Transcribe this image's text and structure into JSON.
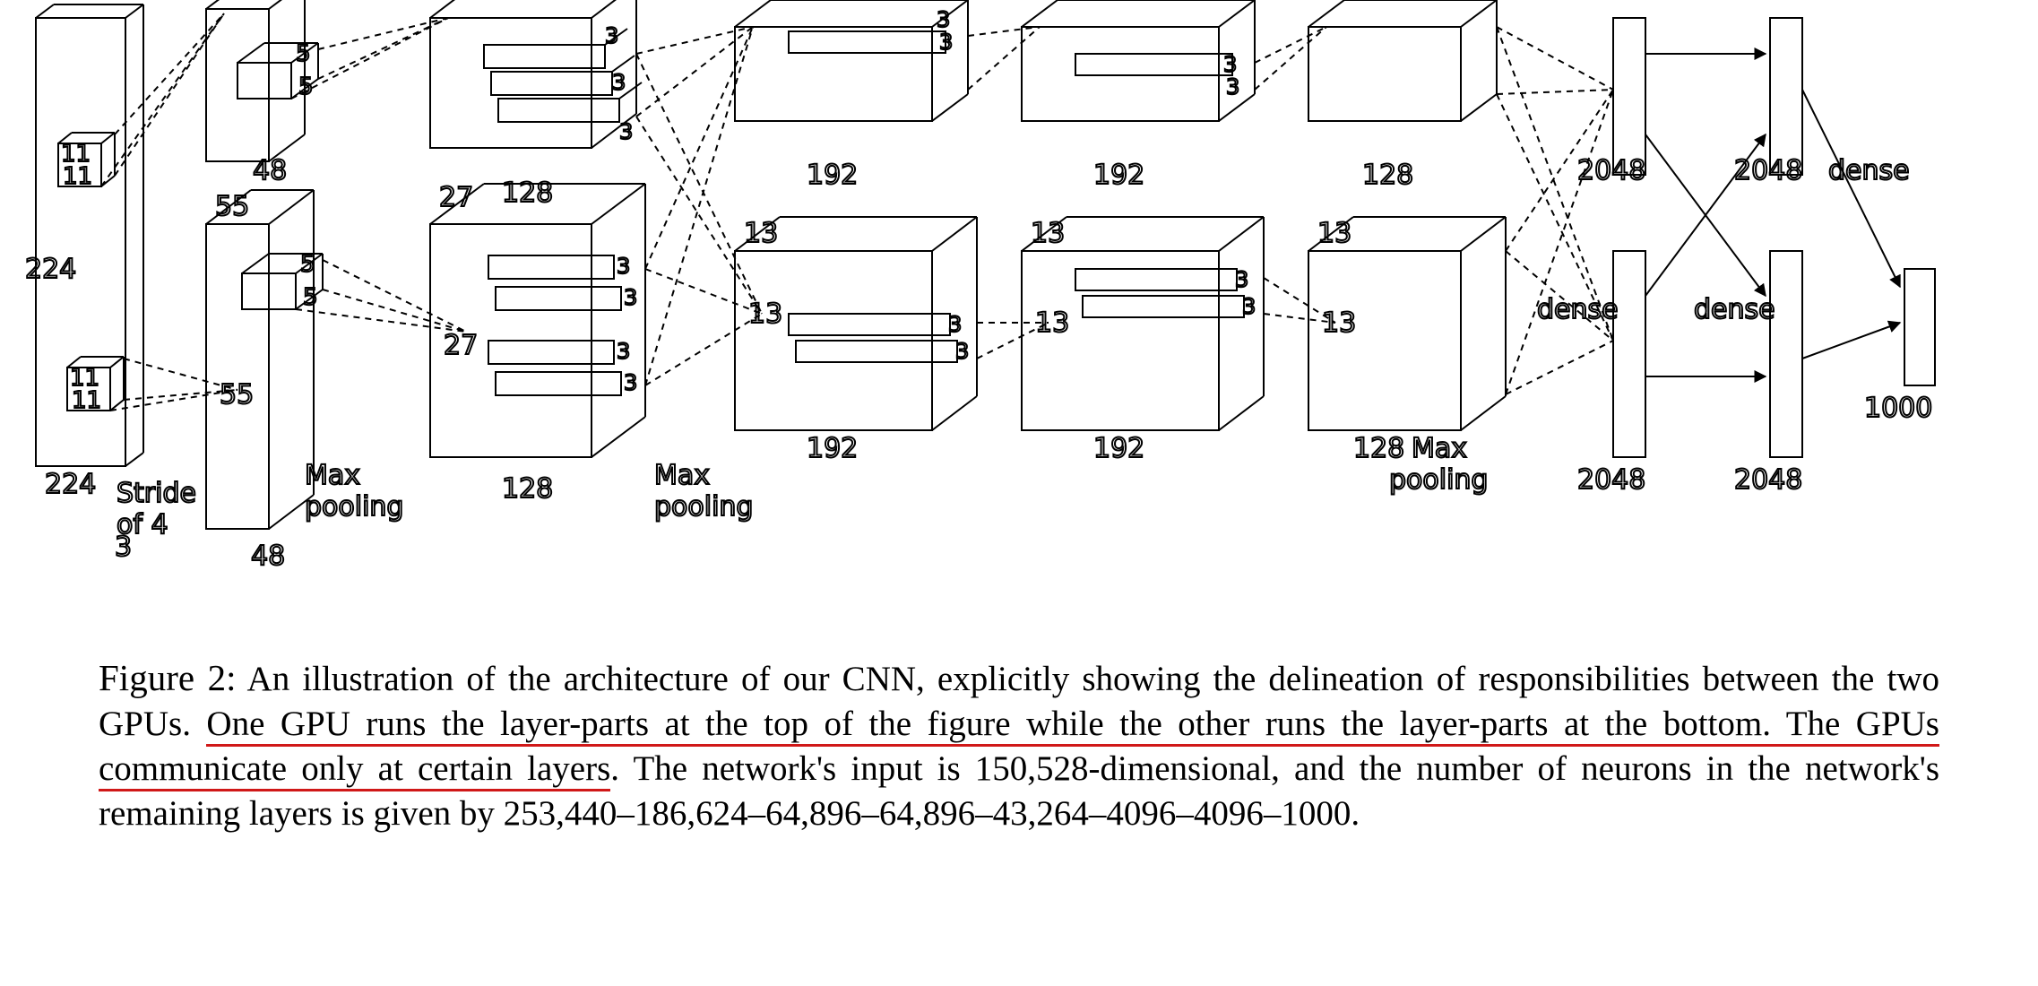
{
  "figure": {
    "label": "Figure 2:",
    "caption_pre": " An illustration of the architecture of our CNN, explicitly showing the delineation of responsibilities between the two GPUs. ",
    "caption_underlined": "One GPU runs the layer-parts at the top of the figure while the other runs the layer-parts at the bottom. The GPUs communicate only at certain layers",
    "caption_post": ". The network's input is 150,528-dimensional, and the number of neurons in the network's remaining layers is given by 253,440–186,624–64,896–64,896–43,264–4096–4096–1000."
  },
  "diagram": {
    "labels": {
      "input_h": "224",
      "input_w": "224",
      "input_c": "3",
      "patch11a": "11",
      "patch11b": "11",
      "stride": "Stride",
      "stride_of": "of 4",
      "l1_size": "55",
      "l1_depth_top": "48",
      "l1_depth_bottom": "48",
      "l1_patch5a": "5",
      "l1_patch5b": "5",
      "maxpool1a": "Max",
      "maxpool1b": "pooling",
      "l2_size": "27",
      "l2_depth_top": "128",
      "l2_depth_bottom": "128",
      "l2_patch3": "3",
      "maxpool2a": "Max",
      "maxpool2b": "pooling",
      "l3_size": "13",
      "l3_depth_top": "192",
      "l3_depth_bottom": "192",
      "l3_patch3": "3",
      "l4_size": "13",
      "l4_depth_top": "192",
      "l4_depth_bottom": "192",
      "l4_patch3": "3",
      "l5_size": "13",
      "l5_depth_top": "128",
      "l5_depth_bottom": "128",
      "maxpool5a": "Max",
      "maxpool5b": "pooling",
      "fc6_top": "2048",
      "fc6_bottom": "2048",
      "fc7_top": "2048",
      "fc7_bottom": "2048",
      "dense1": "dense",
      "dense2": "dense",
      "dense3": "dense",
      "output": "1000"
    }
  }
}
